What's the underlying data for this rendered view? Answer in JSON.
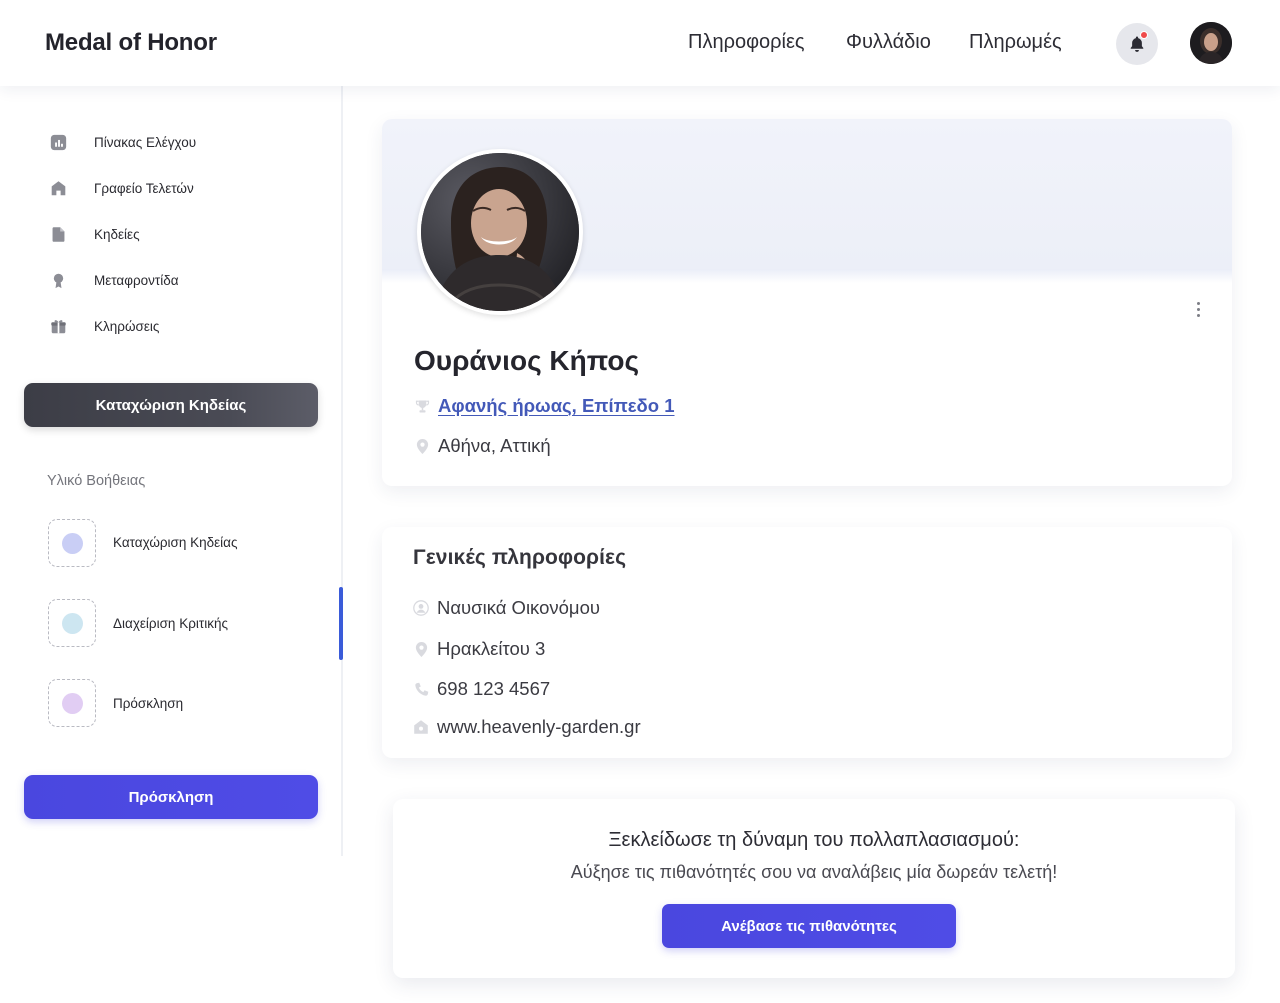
{
  "header": {
    "brand": "Medal of Honor",
    "nav": [
      "Πληροφορίες",
      "Φυλλάδιο",
      "Πληρωμές"
    ],
    "notification_icon": "bell-icon",
    "notification_dot_color": "#ef4a4a"
  },
  "sidebar": {
    "items": [
      {
        "label": "Πίνακας Ελέγχου",
        "icon": "chart-icon"
      },
      {
        "label": "Γραφείο Τελετών",
        "icon": "home-icon"
      },
      {
        "label": "Κηδείες",
        "icon": "document-icon"
      },
      {
        "label": "Μεταφροντίδα",
        "icon": "award-icon"
      },
      {
        "label": "Κληρώσεις",
        "icon": "gift-icon"
      }
    ],
    "register_button": "Καταχώριση Κηδείας",
    "help_title": "Υλικό Βοήθειας",
    "help_items": [
      {
        "label": "Καταχώριση  Κηδείας",
        "color": "#c9cef5"
      },
      {
        "label": "Διαχείριση Κριτικής",
        "color": "#cde6f1"
      },
      {
        "label": "Πρόσκληση",
        "color": "#e1cdf3"
      }
    ],
    "invite_button": "Πρόσκληση"
  },
  "profile": {
    "name": "Ουράνιος Κήπος",
    "rank": "Αφανής ήρωας, Επίπεδο 1",
    "location": "Αθήνα, Αττική"
  },
  "info": {
    "title": "Γενικές πληροφορίες",
    "contact": "Ναυσικά Οικονόμου",
    "address": "Ηρακλείτου 3",
    "phone": "698 123 4567",
    "website": "www.heavenly-garden.gr"
  },
  "promo": {
    "title": "Ξεκλείδωσε τη δύναμη του πολλαπλασιασμού:",
    "subtitle": "Αύξησε τις πιθανότητές σου να αναλάβεις μία δωρεάν τελετή!",
    "button": "Ανέβασε τις πιθανότητες"
  },
  "colors": {
    "accent": "#4a47df",
    "link": "#4359b8",
    "dark_button": "#3c3d46"
  }
}
